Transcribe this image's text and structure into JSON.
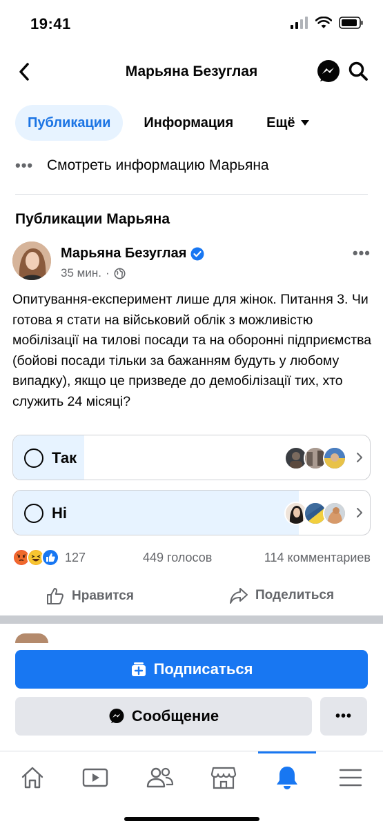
{
  "status_bar": {
    "time": "19:41"
  },
  "header": {
    "title": "Марьяна Безуглая"
  },
  "tabs": [
    {
      "label": "Публикации",
      "active": true
    },
    {
      "label": "Информация",
      "active": false
    },
    {
      "label": "Ещё",
      "active": false
    }
  ],
  "profile": {
    "info_link": "Смотреть информацию Марьяна"
  },
  "section": {
    "title": "Публикации Марьяна"
  },
  "post": {
    "author": "Марьяна Безуглая",
    "time": "35 мин.",
    "separator": "·",
    "text": "Опитування-експеримент лише для жінок. Питання 3. Чи готова я стати на військовий облік з можливістю мобілізації на тилові посади та на оборонні підприємства (бойові посади тільки за бажанням будуть у любому випадку), якщо це призведе до демобілізації тих, хто служить 24 місяці?",
    "poll": [
      {
        "label": "Так",
        "fill_percent": 20
      },
      {
        "label": "Ні",
        "fill_percent": 80
      }
    ],
    "reactions_count": "127",
    "votes": "449 голосов",
    "comments": "114 комментариев",
    "actions": {
      "like": "Нравится",
      "share": "Поделиться"
    }
  },
  "buttons": {
    "subscribe": "Подписаться",
    "message": "Сообщение"
  },
  "colors": {
    "accent": "#1877f2",
    "accent_light": "#e7f3ff",
    "secondary_bg": "#e4e6eb",
    "text_secondary": "#65676b"
  },
  "icons": [
    "back-icon",
    "messenger-icon",
    "search-icon",
    "verified-icon",
    "globe-icon",
    "like-icon",
    "share-icon",
    "home-icon",
    "video-icon",
    "friends-icon",
    "marketplace-icon",
    "bell-icon",
    "menu-icon"
  ]
}
